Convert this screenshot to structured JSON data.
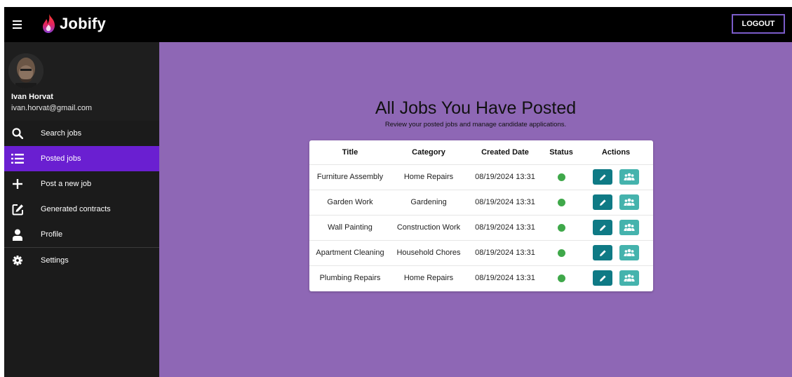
{
  "app": {
    "name": "Jobify",
    "logout_label": "LOGOUT"
  },
  "user": {
    "name": "Ivan Horvat",
    "email": "ivan.horvat@gmail.com"
  },
  "sidebar": {
    "items": [
      {
        "label": "Search jobs",
        "icon": "search-icon",
        "active": false
      },
      {
        "label": "Posted jobs",
        "icon": "list-icon",
        "active": true
      },
      {
        "label": "Post a new job",
        "icon": "plus-icon",
        "active": false
      },
      {
        "label": "Generated contracts",
        "icon": "edit-icon",
        "active": false
      },
      {
        "label": "Profile",
        "icon": "person-icon",
        "active": false
      },
      {
        "label": "Settings",
        "icon": "gear-icon",
        "active": false
      }
    ]
  },
  "main": {
    "title": "All Jobs You Have Posted",
    "subtitle": "Review your posted jobs and manage candidate applications.",
    "table": {
      "headers": [
        "Title",
        "Category",
        "Created Date",
        "Status",
        "Actions"
      ],
      "rows": [
        {
          "title": "Furniture Assembly",
          "category": "Home Repairs",
          "created": "08/19/2024 13:31",
          "status": "active"
        },
        {
          "title": "Garden Work",
          "category": "Gardening",
          "created": "08/19/2024 13:31",
          "status": "active"
        },
        {
          "title": "Wall Painting",
          "category": "Construction Work",
          "created": "08/19/2024 13:31",
          "status": "active"
        },
        {
          "title": "Apartment Cleaning",
          "category": "Household Chores",
          "created": "08/19/2024 13:31",
          "status": "active"
        },
        {
          "title": "Plumbing Repairs",
          "category": "Home Repairs",
          "created": "08/19/2024 13:31",
          "status": "active"
        }
      ]
    }
  },
  "colors": {
    "topbar": "#000000",
    "sidebar": "#1b1b1b",
    "active_nav": "#6a1fd1",
    "main_bg": "#8e67b5",
    "status_active": "#3fa84a",
    "edit_button": "#0f7a85",
    "candidates_button": "#45b3ad",
    "logout_border": "#7b5cc9"
  }
}
